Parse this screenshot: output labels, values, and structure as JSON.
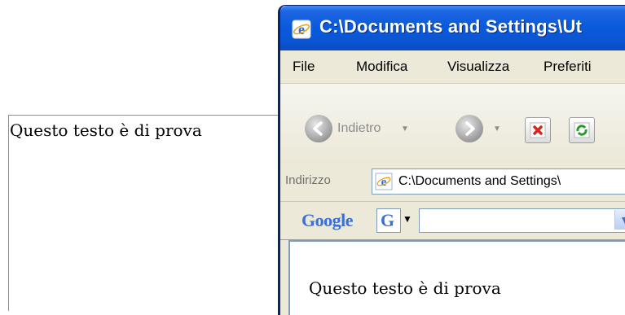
{
  "left_panel": {
    "text": "Questo testo è di prova"
  },
  "ie_window": {
    "title": "C:\\Documents and Settings\\Ut",
    "menu": [
      "File",
      "Modifica",
      "Visualizza",
      "Preferiti"
    ],
    "toolbar": {
      "back_label": "Indietro",
      "back_icon": "back-arrow-icon",
      "forward_icon": "forward-arrow-icon",
      "stop_icon": "stop-icon",
      "refresh_icon": "refresh-icon"
    },
    "address": {
      "label": "Indirizzo",
      "value": "C:\\Documents and Settings\\",
      "icon": "ie-page-icon"
    },
    "google_toolbar": {
      "logo": "Google",
      "button_letter": "G",
      "search_value": ""
    },
    "content": {
      "text": "Questo testo è di prova"
    },
    "colors": {
      "titlebar": "#0a5bdc",
      "chrome": "#ece9d8"
    }
  }
}
